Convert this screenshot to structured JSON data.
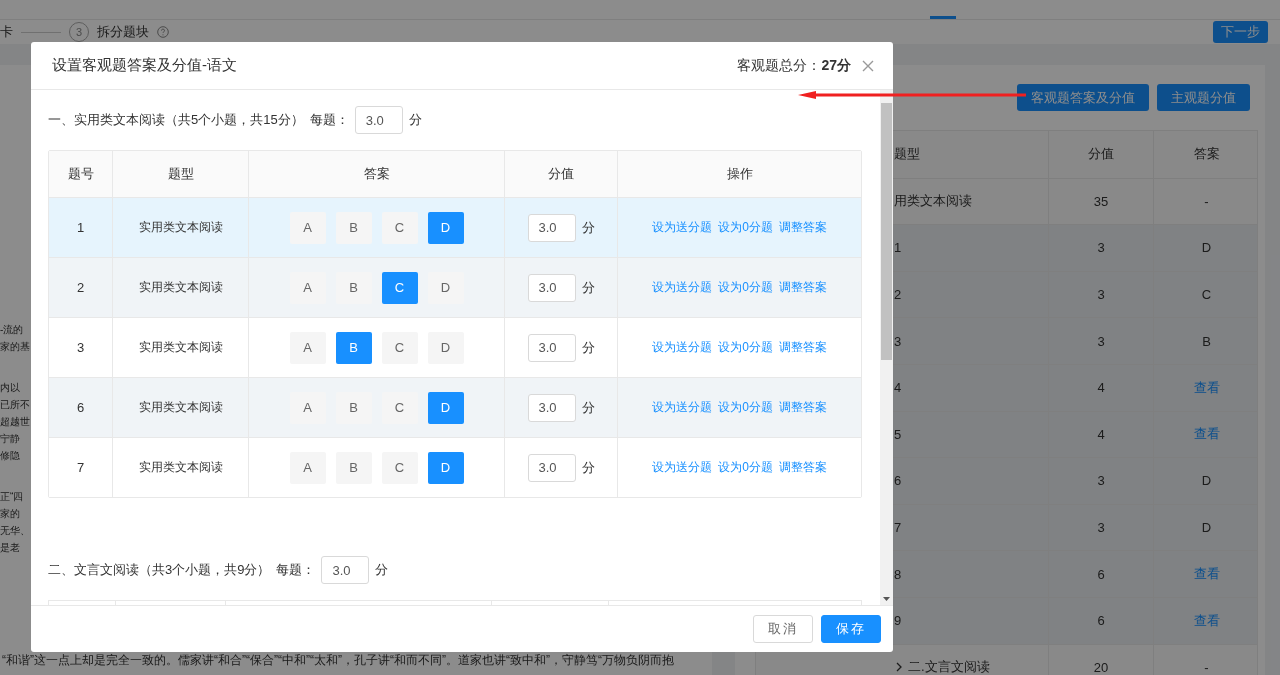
{
  "steps": {
    "previous_tail": "卡",
    "number": "3",
    "label": "拆分题块"
  },
  "next_button": "下一步",
  "article": {
    "paragraphs": [
      [
        "-流的",
        "家的基"
      ],
      [
        "内以",
        "已所不",
        "超越世",
        "宁静",
        "修隐"
      ],
      [
        "正“四",
        "家的",
        "无华、",
        "是老"
      ]
    ],
    "bottom_line": "“和谐”这一点上却是完全一致的。儒家讲“和合”“保合”“中和”“太和”，孔子讲“和而不同”。道家也讲“致中和”，守静笃“万物负阴而抱"
  },
  "side_panel": {
    "buttons": [
      "客观题答案及分值",
      "主观题分值"
    ],
    "columns": [
      "题型",
      "分值",
      "答案"
    ],
    "rows": [
      {
        "kind": "group",
        "label": "用类文本阅读",
        "score": "35",
        "answer": "-",
        "answer_is_link": false,
        "expanded": true
      },
      {
        "kind": "item",
        "label": "1",
        "score": "3",
        "answer": "D",
        "answer_is_link": false
      },
      {
        "kind": "item",
        "label": "2",
        "score": "3",
        "answer": "C",
        "answer_is_link": false
      },
      {
        "kind": "item",
        "label": "3",
        "score": "3",
        "answer": "B",
        "answer_is_link": false
      },
      {
        "kind": "item",
        "label": "4",
        "score": "4",
        "answer": "查看",
        "answer_is_link": true
      },
      {
        "kind": "item",
        "label": "5",
        "score": "4",
        "answer": "查看",
        "answer_is_link": true
      },
      {
        "kind": "item",
        "label": "6",
        "score": "3",
        "answer": "D",
        "answer_is_link": false
      },
      {
        "kind": "item",
        "label": "7",
        "score": "3",
        "answer": "D",
        "answer_is_link": false
      },
      {
        "kind": "item",
        "label": "8",
        "score": "6",
        "answer": "查看",
        "answer_is_link": true
      },
      {
        "kind": "item",
        "label": "9",
        "score": "6",
        "answer": "查看",
        "answer_is_link": true
      },
      {
        "kind": "group",
        "label": "二.文言文阅读",
        "score": "20",
        "answer": "-",
        "answer_is_link": false,
        "expanded": false
      }
    ]
  },
  "modal": {
    "title": "设置客观题答案及分值-语文",
    "total_label": "客观题总分：",
    "total_value": "27分",
    "sections": [
      {
        "heading": "一、实用类文本阅读（共5个小题，共15分）",
        "per_label": "每题：",
        "per_value": "3.0",
        "unit": "分",
        "columns": [
          "题号",
          "题型",
          "答案",
          "分值",
          "操作"
        ],
        "rows": [
          {
            "number": "1",
            "type": "实用类文本阅读",
            "highlighted": true,
            "options": [
              {
                "label": "A",
                "selected": false
              },
              {
                "label": "B",
                "selected": false
              },
              {
                "label": "C",
                "selected": false
              },
              {
                "label": "D",
                "selected": true
              }
            ],
            "score": "3.0",
            "unit": "分",
            "actions": [
              "设为送分题",
              "设为0分题",
              "调整答案"
            ]
          },
          {
            "number": "2",
            "type": "实用类文本阅读",
            "highlighted": false,
            "options": [
              {
                "label": "A",
                "selected": false
              },
              {
                "label": "B",
                "selected": false
              },
              {
                "label": "C",
                "selected": true
              },
              {
                "label": "D",
                "selected": false
              }
            ],
            "score": "3.0",
            "unit": "分",
            "actions": [
              "设为送分题",
              "设为0分题",
              "调整答案"
            ]
          },
          {
            "number": "3",
            "type": "实用类文本阅读",
            "highlighted": false,
            "options": [
              {
                "label": "A",
                "selected": false
              },
              {
                "label": "B",
                "selected": true
              },
              {
                "label": "C",
                "selected": false
              },
              {
                "label": "D",
                "selected": false
              }
            ],
            "score": "3.0",
            "unit": "分",
            "actions": [
              "设为送分题",
              "设为0分题",
              "调整答案"
            ]
          },
          {
            "number": "6",
            "type": "实用类文本阅读",
            "highlighted": false,
            "options": [
              {
                "label": "A",
                "selected": false
              },
              {
                "label": "B",
                "selected": false
              },
              {
                "label": "C",
                "selected": false
              },
              {
                "label": "D",
                "selected": true
              }
            ],
            "score": "3.0",
            "unit": "分",
            "actions": [
              "设为送分题",
              "设为0分题",
              "调整答案"
            ]
          },
          {
            "number": "7",
            "type": "实用类文本阅读",
            "highlighted": false,
            "options": [
              {
                "label": "A",
                "selected": false
              },
              {
                "label": "B",
                "selected": false
              },
              {
                "label": "C",
                "selected": false
              },
              {
                "label": "D",
                "selected": true
              }
            ],
            "score": "3.0",
            "unit": "分",
            "actions": [
              "设为送分题",
              "设为0分题",
              "调整答案"
            ]
          }
        ]
      },
      {
        "heading": "二、文言文阅读（共3个小题，共9分）",
        "per_label": "每题：",
        "per_value": "3.0",
        "unit": "分"
      }
    ],
    "buttons": [
      {
        "kind": "secondary",
        "label": "取消"
      },
      {
        "kind": "primary",
        "label": "保存"
      }
    ]
  }
}
